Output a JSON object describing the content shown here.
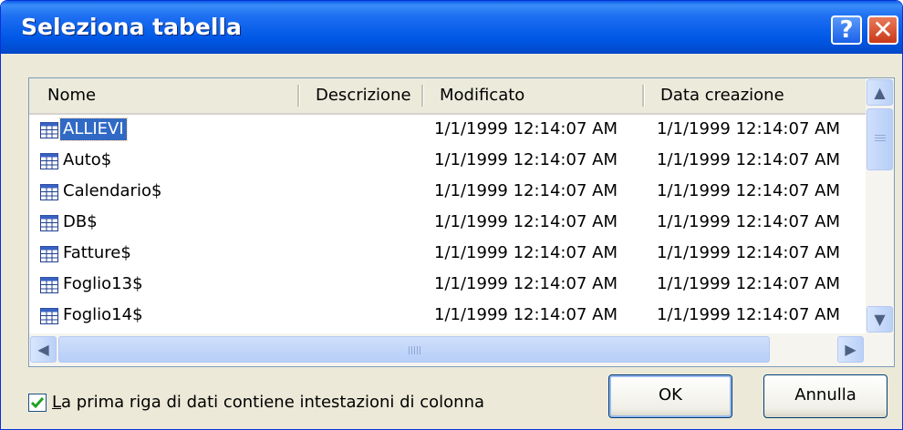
{
  "window": {
    "title": "Seleziona tabella"
  },
  "titlebar": {
    "help_label": "?",
    "close_label": "✕"
  },
  "columns": [
    "Nome",
    "Descrizione",
    "Modificato",
    "Data creazione"
  ],
  "rows": [
    {
      "name": "ALLIEVI",
      "description": "",
      "modified": "1/1/1999 12:14:07 AM",
      "created": "1/1/1999 12:14:07 AM",
      "selected": true
    },
    {
      "name": "Auto$",
      "description": "",
      "modified": "1/1/1999 12:14:07 AM",
      "created": "1/1/1999 12:14:07 AM"
    },
    {
      "name": "Calendario$",
      "description": "",
      "modified": "1/1/1999 12:14:07 AM",
      "created": "1/1/1999 12:14:07 AM"
    },
    {
      "name": "DB$",
      "description": "",
      "modified": "1/1/1999 12:14:07 AM",
      "created": "1/1/1999 12:14:07 AM"
    },
    {
      "name": "Fatture$",
      "description": "",
      "modified": "1/1/1999 12:14:07 AM",
      "created": "1/1/1999 12:14:07 AM"
    },
    {
      "name": "Foglio13$",
      "description": "",
      "modified": "1/1/1999 12:14:07 AM",
      "created": "1/1/1999 12:14:07 AM"
    },
    {
      "name": "Foglio14$",
      "description": "",
      "modified": "1/1/1999 12:14:07 AM",
      "created": "1/1/1999 12:14:07 AM"
    }
  ],
  "scrollbars": {
    "up": "▲",
    "down": "▼",
    "left": "◀",
    "right": "▶"
  },
  "checkbox": {
    "checked": true,
    "label_first": "L",
    "label_rest": "a prima riga di dati contiene intestazioni di colonna"
  },
  "buttons": {
    "ok": "OK",
    "cancel": "Annulla"
  },
  "colors": {
    "titlebar": "#0058e6",
    "selection": "#316ac5",
    "dialog_bg": "#ece9d8",
    "check": "#21a121"
  }
}
